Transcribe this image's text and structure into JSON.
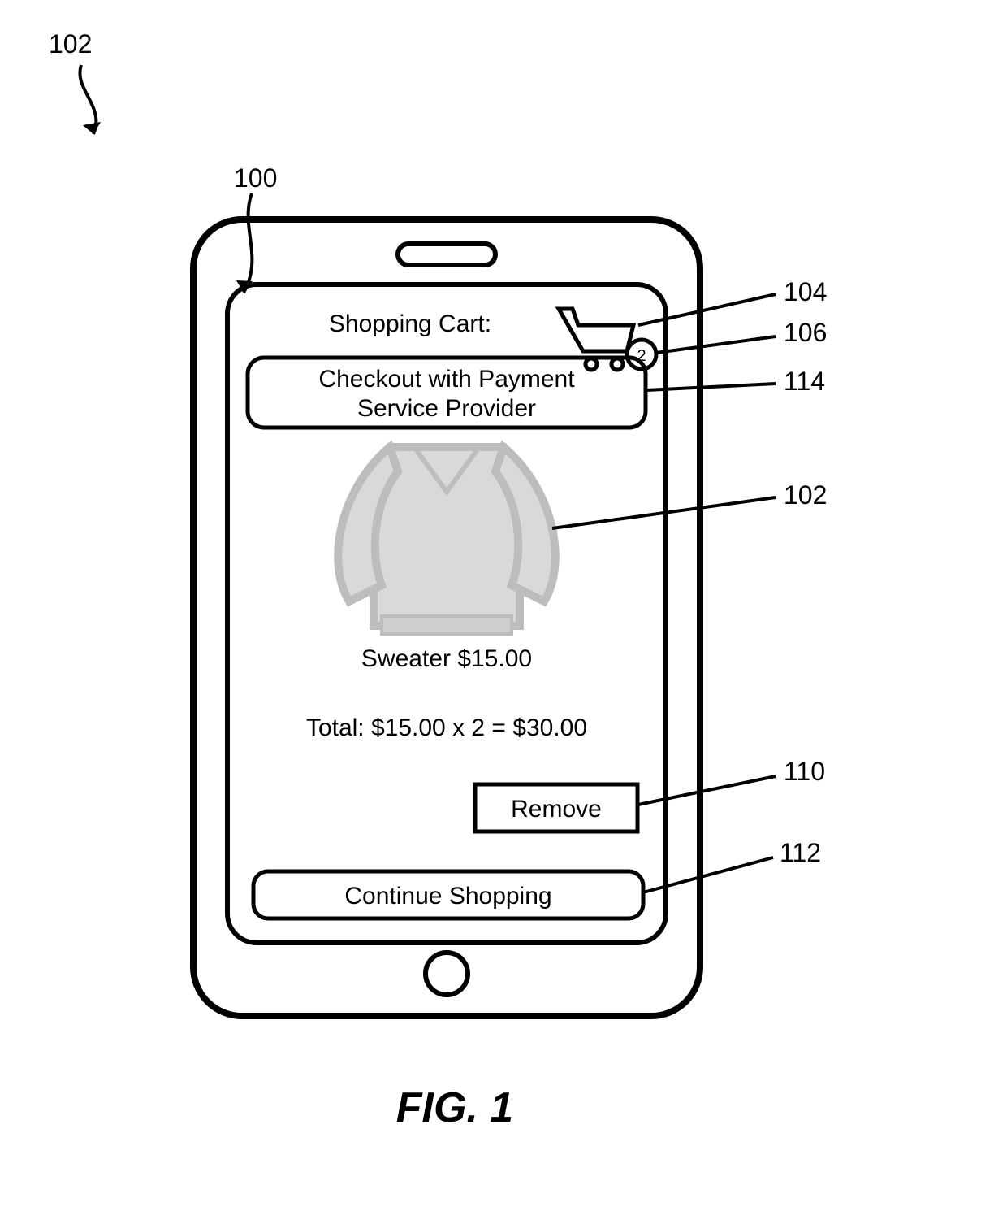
{
  "figure": {
    "top_ref": "102",
    "caption": "FIG. 1",
    "callouts": {
      "c100": "100",
      "c104": "104",
      "c106": "106",
      "c114": "114",
      "c102": "102",
      "c110": "110",
      "c112": "112"
    }
  },
  "ui": {
    "title": "Shopping Cart:",
    "cart_badge": "2",
    "checkout_label_line1": "Checkout with Payment",
    "checkout_label_line2": "Service Provider",
    "product_name": "Sweater",
    "product_price": "$15.00",
    "total_line": "Total: $15.00 x 2 = $30.00",
    "remove_label": "Remove",
    "continue_label": "Continue Shopping"
  }
}
